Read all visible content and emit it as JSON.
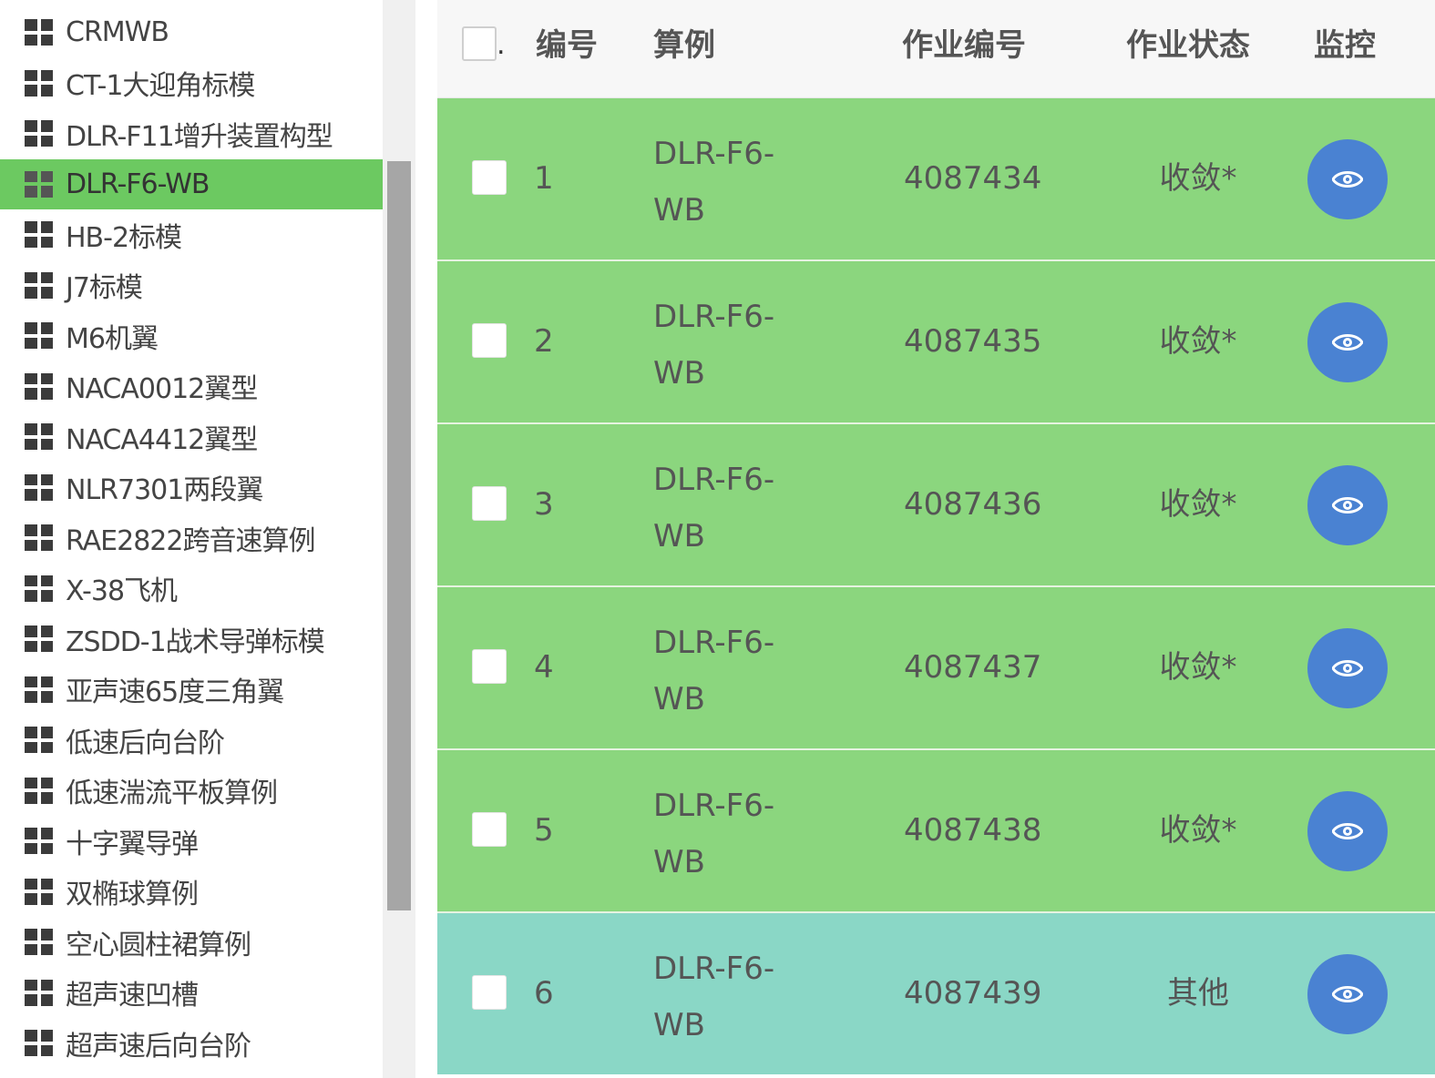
{
  "sidebar": {
    "items": [
      {
        "label": "CRMWB"
      },
      {
        "label": "CT-1大迎角标模"
      },
      {
        "label": "DLR-F11增升装置构型"
      },
      {
        "label": "DLR-F6-WB",
        "active": true
      },
      {
        "label": "HB-2标模"
      },
      {
        "label": "J7标模"
      },
      {
        "label": "M6机翼"
      },
      {
        "label": "NACA0012翼型"
      },
      {
        "label": "NACA4412翼型"
      },
      {
        "label": "NLR7301两段翼"
      },
      {
        "label": "RAE2822跨音速算例"
      },
      {
        "label": "X-38飞机"
      },
      {
        "label": "ZSDD-1战术导弹标模"
      },
      {
        "label": "亚声速65度三角翼"
      },
      {
        "label": "低速后向台阶"
      },
      {
        "label": "低速湍流平板算例"
      },
      {
        "label": "十字翼导弹"
      },
      {
        "label": "双椭球算例"
      },
      {
        "label": "空心圆柱裙算例"
      },
      {
        "label": "超声速凹槽"
      },
      {
        "label": "超声速后向台阶"
      }
    ]
  },
  "table": {
    "header": {
      "dot": ".",
      "index": "编号",
      "case": "算例",
      "job_id": "作业编号",
      "status": "作业状态",
      "monitor": "监控"
    },
    "rows": [
      {
        "index": "1",
        "case": "DLR-F6-WB",
        "job_id": "4087434",
        "status": "收敛*",
        "state": "converged"
      },
      {
        "index": "2",
        "case": "DLR-F6-WB",
        "job_id": "4087435",
        "status": "收敛*",
        "state": "converged"
      },
      {
        "index": "3",
        "case": "DLR-F6-WB",
        "job_id": "4087436",
        "status": "收敛*",
        "state": "converged"
      },
      {
        "index": "4",
        "case": "DLR-F6-WB",
        "job_id": "4087437",
        "status": "收敛*",
        "state": "converged"
      },
      {
        "index": "5",
        "case": "DLR-F6-WB",
        "job_id": "4087438",
        "status": "收敛*",
        "state": "converged"
      },
      {
        "index": "6",
        "case": "DLR-F6-WB",
        "job_id": "4087439",
        "status": "其他",
        "state": "other"
      }
    ]
  },
  "icons": {
    "sidebar_item": "grid-icon",
    "monitor_button": "eye-icon"
  },
  "colors": {
    "active_item": "#6cc961",
    "row_converged": "#8bd67e",
    "row_other": "#8ad7c6",
    "monitor_button": "#4a82d2"
  }
}
